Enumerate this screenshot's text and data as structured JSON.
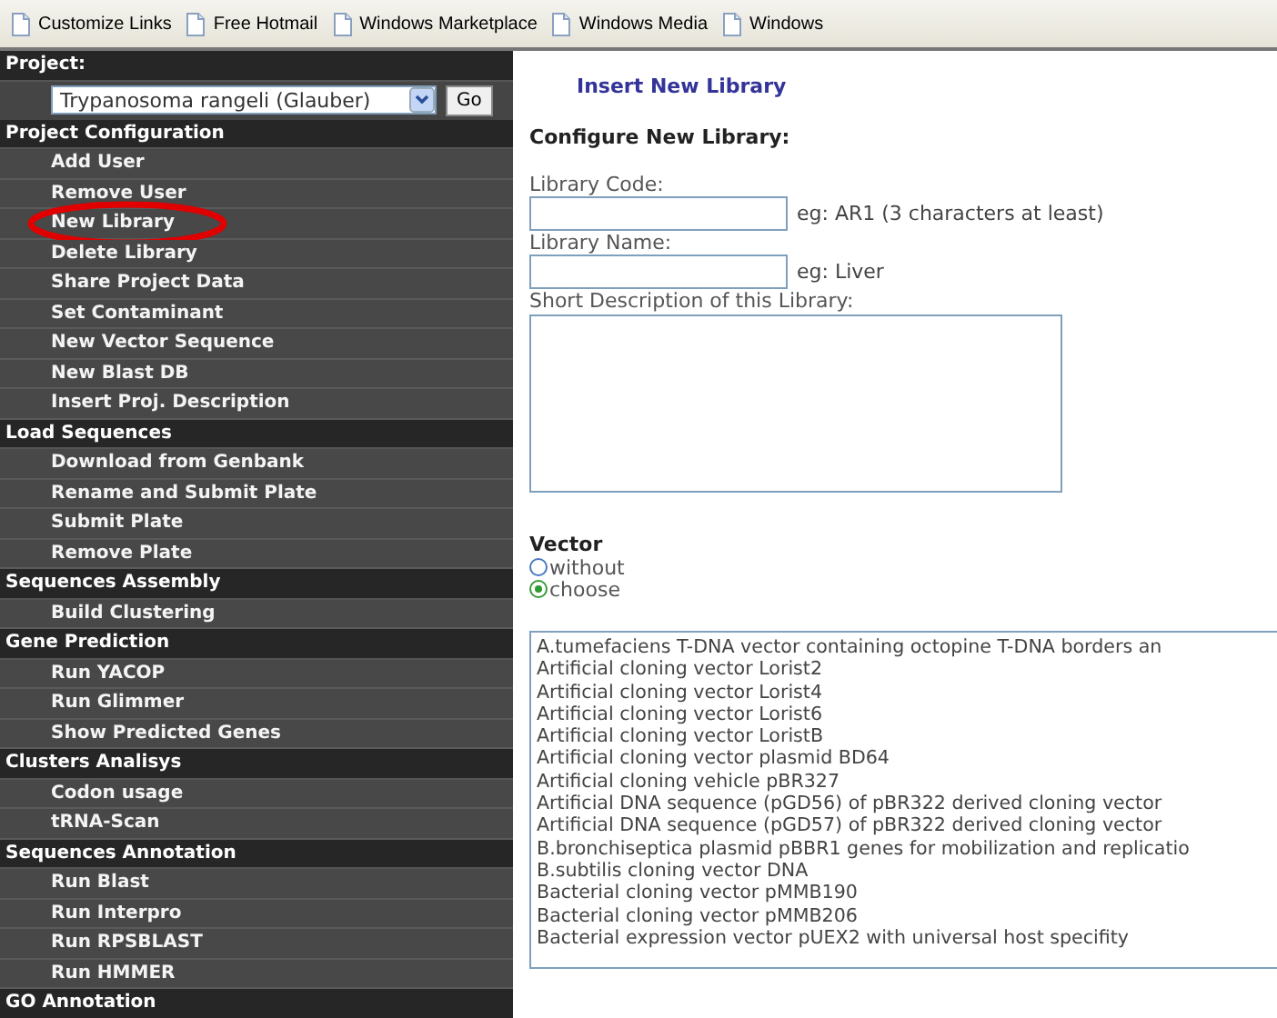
{
  "bookmarks": [
    "Customize Links",
    "Free Hotmail",
    "Windows Marketplace",
    "Windows Media",
    "Windows"
  ],
  "sidebar": {
    "project_label": "Project:",
    "project_select": "Trypanosoma rangeli (Glauber)",
    "go_button": "Go",
    "sections": [
      {
        "title": "Project Configuration",
        "items": [
          {
            "label": "Add User",
            "circled": false
          },
          {
            "label": "Remove User",
            "circled": false
          },
          {
            "label": "New Library",
            "circled": true
          },
          {
            "label": "Delete Library",
            "circled": false
          },
          {
            "label": "Share Project Data",
            "circled": false
          },
          {
            "label": "Set Contaminant",
            "circled": false
          },
          {
            "label": "New Vector Sequence",
            "circled": false
          },
          {
            "label": "New Blast DB",
            "circled": false
          },
          {
            "label": "Insert Proj. Description",
            "circled": false
          }
        ]
      },
      {
        "title": "Load Sequences",
        "items": [
          {
            "label": "Download from Genbank",
            "circled": false
          },
          {
            "label": "Rename and Submit Plate",
            "circled": false
          },
          {
            "label": "Submit Plate",
            "circled": false
          },
          {
            "label": "Remove Plate",
            "circled": false
          }
        ]
      },
      {
        "title": "Sequences Assembly",
        "items": [
          {
            "label": "Build Clustering",
            "circled": false
          }
        ]
      },
      {
        "title": "Gene Prediction",
        "items": [
          {
            "label": "Run YACOP",
            "circled": false
          },
          {
            "label": "Run Glimmer",
            "circled": false
          },
          {
            "label": "Show Predicted Genes",
            "circled": false
          }
        ]
      },
      {
        "title": "Clusters Analisys",
        "items": [
          {
            "label": "Codon usage",
            "circled": false
          },
          {
            "label": "tRNA-Scan",
            "circled": false
          }
        ]
      },
      {
        "title": "Sequences Annotation",
        "items": [
          {
            "label": "Run Blast",
            "circled": false
          },
          {
            "label": "Run Interpro",
            "circled": false
          },
          {
            "label": "Run RPSBLAST",
            "circled": false
          },
          {
            "label": "Run HMMER",
            "circled": false
          }
        ]
      },
      {
        "title": "GO Annotation"
      }
    ]
  },
  "form": {
    "page_title": "Insert New Library",
    "heading": "Configure New Library:",
    "code_label": "Library Code:",
    "code_hint": "eg: AR1 (3 characters at least)",
    "name_label": "Library Name:",
    "name_hint": "eg: Liver",
    "description_label": "Short Description of this Library:",
    "vector_label": "Vector",
    "vector_options": [
      {
        "label": "without",
        "selected": false
      },
      {
        "label": "choose",
        "selected": true
      }
    ],
    "vector_list": [
      "A.tumefaciens T-DNA vector containing octopine T-DNA borders an",
      "Artificial cloning vector Lorist2",
      "Artificial cloning vector Lorist4",
      "Artificial cloning vector Lorist6",
      "Artificial cloning vector LoristB",
      "Artificial cloning vector plasmid BD64",
      "Artificial cloning vehicle pBR327",
      "Artificial DNA sequence (pGD56) of pBR322 derived cloning vector",
      "Artificial DNA sequence (pGD57) of pBR322 derived cloning vector",
      "B.bronchiseptica plasmid pBBR1 genes for mobilization and replicatio",
      "B.subtilis cloning vector DNA",
      "Bacterial cloning vector pMMB190",
      "Bacterial cloning vector pMMB206",
      "Bacterial expression vector pUEX2 with universal host specifity"
    ]
  }
}
